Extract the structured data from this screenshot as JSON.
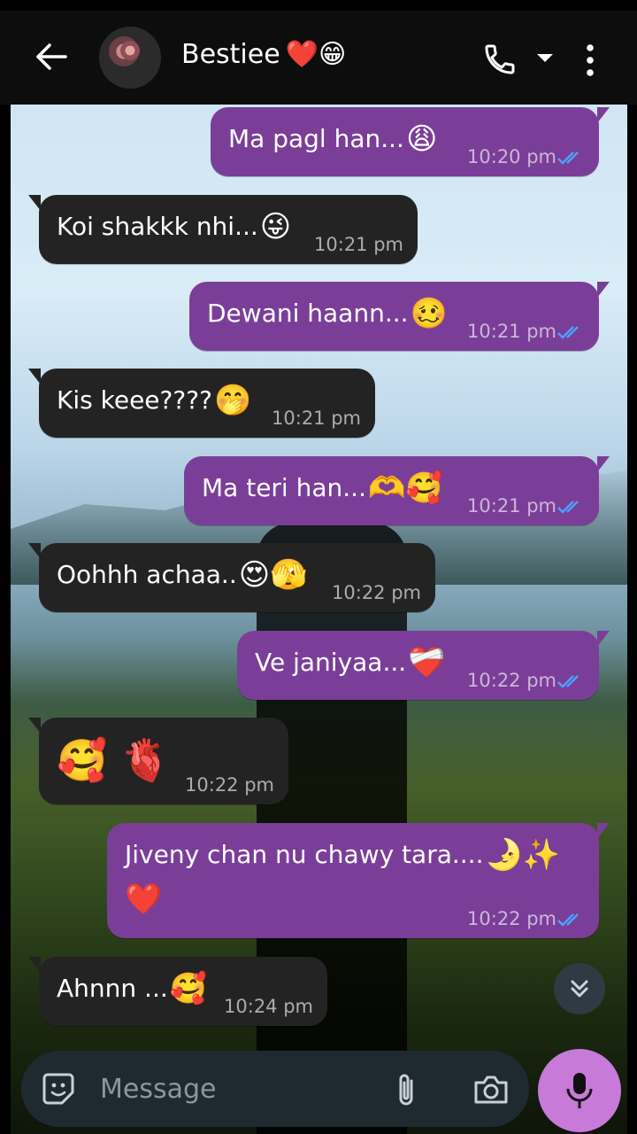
{
  "header": {
    "contact_name": "Bestiee",
    "contact_emojis": "❤️😁",
    "icons": [
      "back-arrow-icon",
      "voice-call-icon",
      "chevron-down-icon",
      "more-vert-icon"
    ]
  },
  "messages": [
    {
      "side": "out",
      "text": "Ma pagl han...",
      "emoji": "😩",
      "time": "10:20 pm",
      "ticks": "read"
    },
    {
      "side": "in",
      "text": "Koi shakkk nhi...",
      "emoji": "😜",
      "time": "10:21 pm"
    },
    {
      "side": "out",
      "text": "Dewani haann...",
      "emoji": "🥴",
      "time": "10:21 pm",
      "ticks": "read"
    },
    {
      "side": "in",
      "text": "Kis keee????",
      "emoji": "🤭",
      "time": "10:21 pm"
    },
    {
      "side": "out",
      "text": "Ma teri han...",
      "emoji": "🫶🥰",
      "time": "10:21 pm",
      "ticks": "read"
    },
    {
      "side": "in",
      "text": "Oohhh achaa..",
      "emoji": "😍🫣",
      "time": "10:22 pm"
    },
    {
      "side": "out",
      "text": "Ve janiyaa...",
      "emoji": "❤️‍🩹",
      "time": "10:22 pm",
      "ticks": "read"
    },
    {
      "side": "in",
      "text": "",
      "emoji": "🥰 🫀",
      "time": "10:22 pm"
    },
    {
      "side": "out",
      "text": "Jiveny chan nu chawy tara....",
      "emoji": "🌛✨",
      "emoji2": "❤️",
      "time": "10:22 pm",
      "ticks": "read"
    },
    {
      "side": "in",
      "text": "Ahnnn ...",
      "emoji": "🥰",
      "time": "10:24 pm"
    }
  ],
  "composer": {
    "placeholder": "Message",
    "icons": [
      "sticker-icon",
      "attach-icon",
      "camera-icon",
      "mic-icon"
    ]
  },
  "colors": {
    "outgoing_bubble": "#7a3e98",
    "incoming_bubble": "#232323",
    "mic_button": "#c87ad8",
    "read_ticks": "#4aa3ff"
  }
}
